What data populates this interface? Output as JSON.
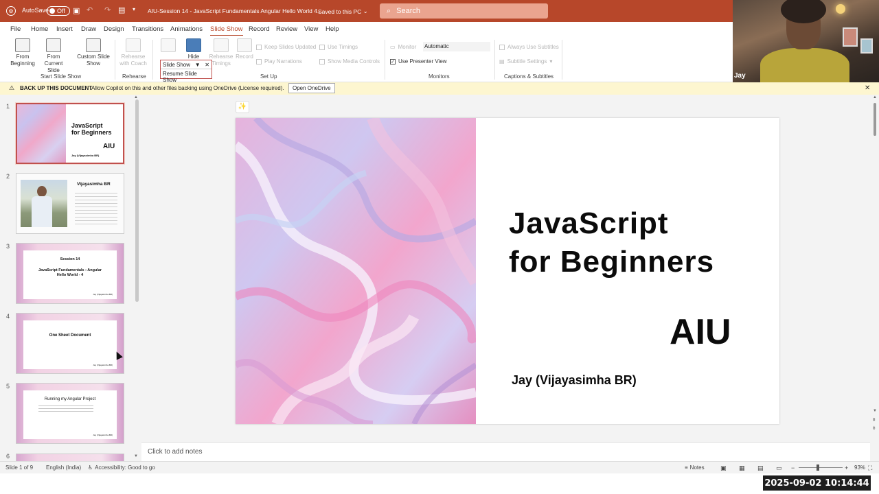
{
  "titlebar": {
    "autosave_label": "AutoSave",
    "autosave_state": "Off",
    "doc_title": "AIU-Session 14 - JavaScript Fundamentals  Angular Hello World 4...",
    "save_status": "Saved to this PC",
    "search_placeholder": "Search"
  },
  "webcam": {
    "name": "Jay"
  },
  "menu": [
    "File",
    "Home",
    "Insert",
    "Draw",
    "Design",
    "Transitions",
    "Animations",
    "Slide Show",
    "Record",
    "Review",
    "View",
    "Help"
  ],
  "ribbon": {
    "from_beginning": [
      "From",
      "Beginning"
    ],
    "from_current": [
      "From",
      "Current Slide"
    ],
    "custom_show": [
      "Custom Slide",
      "Show"
    ],
    "rehearse_coach": [
      "Rehearse",
      "with Coach"
    ],
    "setup_hide": [
      "Hide"
    ],
    "rehearse_timings": [
      "Rehearse",
      "Timings"
    ],
    "record": [
      "Record"
    ],
    "set_up": [
      "Set Up"
    ],
    "keep_slides_updated": "Keep Slides Updated",
    "use_timings": "Use Timings",
    "play_narrations": "Play Narrations",
    "show_media_controls": "Show Media Controls",
    "monitor_label": "Monitor",
    "monitor_value": "Automatic",
    "use_presenter_view": "Use Presenter View",
    "always_use_subtitles": "Always Use Subtitles",
    "subtitle_settings": "Subtitle Settings",
    "groups": {
      "start": "Start Slide Show",
      "rehearse": "Rehearse",
      "setup": "Set Up",
      "monitors": "Monitors",
      "captions": "Captions & Subtitles"
    }
  },
  "popup": {
    "title": "Slide Show",
    "resume": "Resume Slide Show"
  },
  "infobar": {
    "heading": "BACK UP THIS DOCUMENT",
    "message": "Allow Copilot on this and other files backing using OneDrive (License required).",
    "button": "Open OneDrive"
  },
  "thumbnails": [
    {
      "num": "1",
      "line1": "JavaScript",
      "line2": "for Beginners",
      "aiu": "AIU",
      "author": "Jay (Vijayasimha BR)"
    },
    {
      "num": "2",
      "title": "Vijayasimha BR"
    },
    {
      "num": "3",
      "line1": "Session 14",
      "line2": "JavaScript Fundamentals : Angular",
      "line3": "Hello World - 4",
      "footer": "Jay (Vijayasimha BR)"
    },
    {
      "num": "4",
      "title": "One Sheet Document",
      "footer": "Jay (Vijayasimha BR)"
    },
    {
      "num": "5",
      "title": "Running my Angular Project",
      "footer": "Jay (Vijayasimha BR)"
    },
    {
      "num": "6"
    }
  ],
  "slide": {
    "title_line1": "JavaScript",
    "title_line2": "for Beginners",
    "aiu": "AIU",
    "author": "Jay (Vijayasimha BR)"
  },
  "notes_placeholder": "Click to add notes",
  "status": {
    "slide_counter": "Slide 1 of 9",
    "language": "English (India)",
    "accessibility": "Accessibility: Good to go",
    "notes": "Notes",
    "zoom": "93%"
  },
  "timestamp": "2025-09-02  10:14:44",
  "colors": {
    "accent": "#b7472a",
    "selection": "#c0504d"
  }
}
